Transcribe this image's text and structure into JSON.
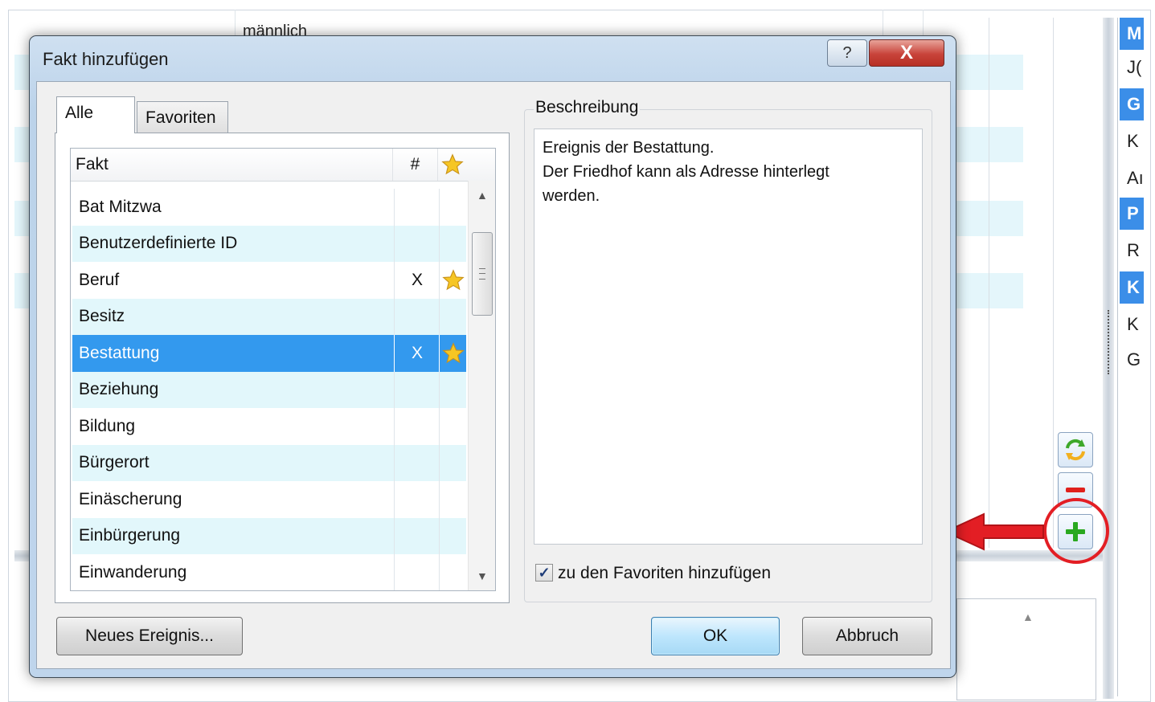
{
  "background": {
    "top_text": "männlich",
    "right_panel_letters": [
      {
        "text": "M",
        "highlight": true
      },
      {
        "text": "J(",
        "highlight": false
      },
      {
        "text": "G",
        "highlight": true
      },
      {
        "text": "K",
        "highlight": false
      },
      {
        "text": "Aı",
        "highlight": false
      },
      {
        "text": "P",
        "highlight": true
      },
      {
        "text": "R",
        "highlight": false
      },
      {
        "text": "K",
        "highlight": true
      },
      {
        "text": "K",
        "highlight": false
      },
      {
        "text": "G",
        "highlight": false
      }
    ],
    "side_buttons": [
      "refresh-icon",
      "minus-icon",
      "plus-icon"
    ],
    "annotation_color": "#e31e24"
  },
  "dialog": {
    "title": "Fakt hinzufügen",
    "help_label": "?",
    "close_label": "X",
    "tabs": [
      {
        "label": "Alle",
        "active": true
      },
      {
        "label": "Favoriten",
        "active": false
      }
    ],
    "list": {
      "headers": {
        "fakt": "Fakt",
        "count": "#",
        "favorite_icon": "star-icon"
      },
      "rows": [
        {
          "name": "Bat Mitzwa",
          "count": "",
          "favorite": false,
          "selected": false
        },
        {
          "name": "Benutzerdefinierte ID",
          "count": "",
          "favorite": false,
          "selected": false
        },
        {
          "name": "Beruf",
          "count": "X",
          "favorite": true,
          "selected": false
        },
        {
          "name": "Besitz",
          "count": "",
          "favorite": false,
          "selected": false
        },
        {
          "name": "Bestattung",
          "count": "X",
          "favorite": true,
          "selected": true
        },
        {
          "name": "Beziehung",
          "count": "",
          "favorite": false,
          "selected": false
        },
        {
          "name": "Bildung",
          "count": "",
          "favorite": false,
          "selected": false
        },
        {
          "name": "Bürgerort",
          "count": "",
          "favorite": false,
          "selected": false
        },
        {
          "name": "Einäscherung",
          "count": "",
          "favorite": false,
          "selected": false
        },
        {
          "name": "Einbürgerung",
          "count": "",
          "favorite": false,
          "selected": false
        },
        {
          "name": "Einwanderung",
          "count": "",
          "favorite": false,
          "selected": false
        }
      ]
    },
    "description": {
      "label": "Beschreibung",
      "text": "Ereignis der Bestattung.\nDer Friedhof kann als Adresse hinterlegt\nwerden."
    },
    "favorite_checkbox": {
      "label": "zu den Favoriten hinzufügen",
      "checked": true
    },
    "buttons": {
      "new_event": "Neues Ereignis...",
      "ok": "OK",
      "cancel": "Abbruch"
    },
    "colors": {
      "selection": "#3399ee",
      "alt_row": "#e2f7fb",
      "star": "#f6c624"
    }
  }
}
